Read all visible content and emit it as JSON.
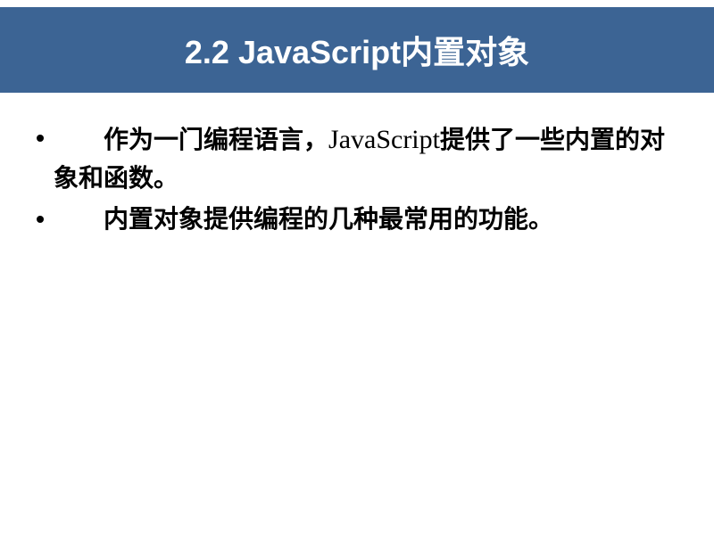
{
  "title": "2.2  JavaScript内置对象",
  "bullets": [
    {
      "pre_text": "作为一门编程语言，",
      "js_text": "JavaScript",
      "post_text": "提供了一些内置的对象和函数。"
    },
    {
      "pre_text": "内置对象提供编程的几种最常用的功能。",
      "js_text": "",
      "post_text": ""
    }
  ]
}
